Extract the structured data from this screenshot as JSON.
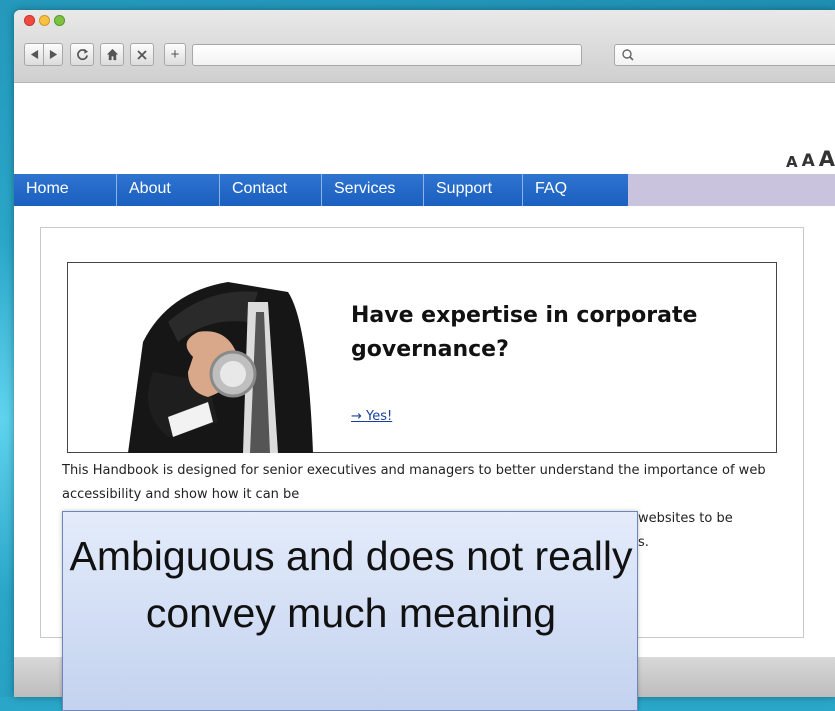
{
  "browser": {
    "icons": {
      "back": "back-arrow-icon",
      "forward": "forward-arrow-icon",
      "reload": "reload-icon",
      "home": "home-icon",
      "stop": "close-icon",
      "new_tab": "plus-icon",
      "search": "search-icon"
    },
    "new_tab_label": "+"
  },
  "font_size_controls": [
    "A",
    "A",
    "A"
  ],
  "nav": {
    "items": [
      {
        "label": "Home"
      },
      {
        "label": "About"
      },
      {
        "label": "Contact"
      },
      {
        "label": "Services"
      },
      {
        "label": "Support"
      },
      {
        "label": "FAQ"
      }
    ]
  },
  "banner": {
    "heading": "Have expertise in corporate governance?",
    "link": "→ Yes!"
  },
  "body_text": "This Handbook is designed for senior executives and managers to better understand the importance of web accessibility and show how it can be",
  "body_text_partial_line3": "websites to be",
  "body_text_partial_line4": "s.",
  "callout": {
    "text": "Ambiguous and does not really convey much meaning"
  },
  "colors": {
    "nav_blue": "#1f63c4",
    "nav_strip": "#c9c3dd",
    "callout_bg": "#d4def5",
    "link": "#1b3fa0"
  }
}
